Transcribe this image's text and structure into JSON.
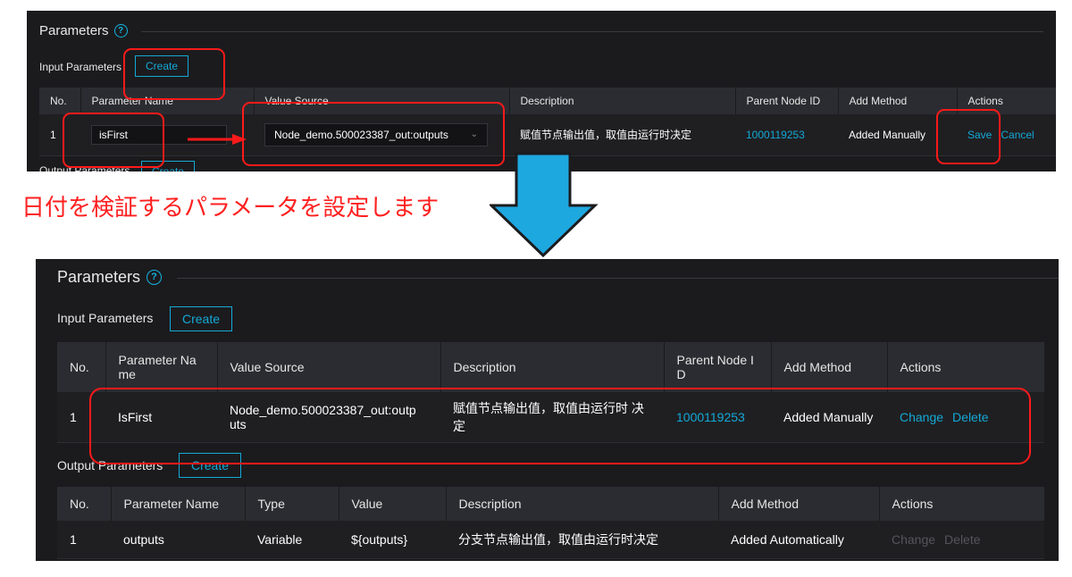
{
  "annotation": {
    "caption": "日付を検証するパラメータを設定します",
    "highlight_color": "#ff1a1a",
    "arrow_color": "#1ea8e0"
  },
  "top": {
    "section_title": "Parameters",
    "help_icon": "?",
    "input_label": "Input Parameters",
    "create_label": "Create",
    "output_label": "Output Parameters",
    "headers": [
      "No.",
      "Parameter Name",
      "Value Source",
      "Description",
      "Parent Node ID",
      "Add Method",
      "Actions"
    ],
    "row": {
      "no": "1",
      "name_value": "isFirst",
      "source_value": "Node_demo.500023387_out:outputs",
      "description": "赋值节点输出值，取值由运行时决定",
      "parent_node_id": "1000119253",
      "add_method": "Added Manually",
      "save": "Save",
      "cancel": "Cancel"
    }
  },
  "bottom": {
    "section_title": "Parameters",
    "help_icon": "?",
    "input_label": "Input Parameters",
    "create_label": "Create",
    "input_headers": [
      "No.",
      "Parameter Na me",
      "Value Source",
      "Description",
      "Parent Node I D",
      "Add Method",
      "Actions"
    ],
    "input_row": {
      "no": "1",
      "name": "IsFirst",
      "source": "Node_demo.500023387_out:outp uts",
      "description": "赋值节点输出值，取值由运行时 决定",
      "parent_node_id": "1000119253",
      "add_method": "Added Manually",
      "change": "Change",
      "delete": "Delete"
    },
    "output_label": "Output Parameters",
    "output_create_label": "Create",
    "output_headers": [
      "No.",
      "Parameter Name",
      "Type",
      "Value",
      "Description",
      "Add Method",
      "Actions"
    ],
    "output_row": {
      "no": "1",
      "name": "outputs",
      "type": "Variable",
      "value": "${outputs}",
      "description": "分支节点输出值，取值由运行时决定",
      "add_method": "Added Automatically",
      "change": "Change",
      "delete": "Delete"
    }
  }
}
